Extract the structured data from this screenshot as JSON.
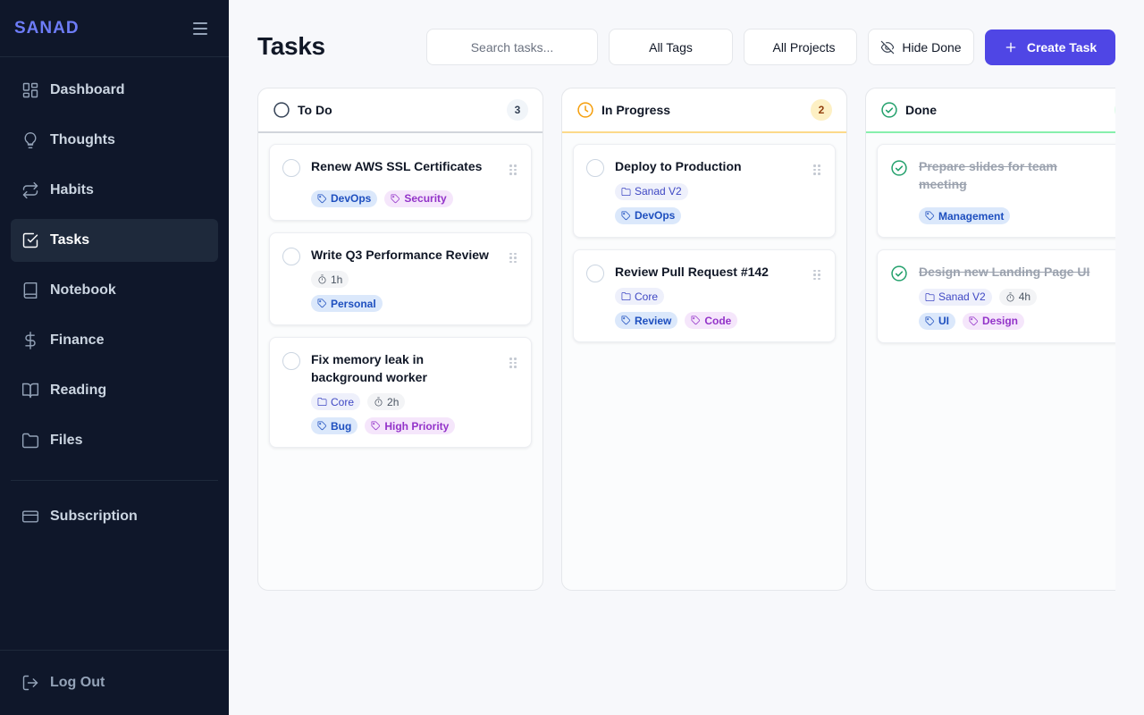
{
  "app": {
    "brand": "SANAD"
  },
  "sidebar": {
    "items": [
      {
        "label": "Dashboard",
        "icon": "grid-icon"
      },
      {
        "label": "Thoughts",
        "icon": "lightbulb-icon"
      },
      {
        "label": "Habits",
        "icon": "repeat-icon"
      },
      {
        "label": "Tasks",
        "icon": "checkbox-icon",
        "active": true
      },
      {
        "label": "Notebook",
        "icon": "notebook-icon"
      },
      {
        "label": "Finance",
        "icon": "dollar-icon"
      },
      {
        "label": "Reading",
        "icon": "book-open-icon"
      },
      {
        "label": "Files",
        "icon": "folder-icon"
      }
    ],
    "subscription": {
      "label": "Subscription",
      "icon": "credit-card-icon"
    },
    "logout": {
      "label": "Log Out",
      "icon": "logout-icon"
    }
  },
  "header": {
    "title": "Tasks",
    "search_placeholder": "Search tasks...",
    "tags_filter": "All Tags",
    "projects_filter": "All Projects",
    "hide_done": "Hide Done",
    "create_task": "Create Task"
  },
  "colors": {
    "accent": "#4f46e5",
    "todo": "#d1d5db",
    "in_progress": "#f59e0b",
    "done": "#22a06b"
  },
  "columns": [
    {
      "title": "To Do",
      "count": "3",
      "status_icon": "circle-icon",
      "cards": [
        {
          "title": "Renew AWS SSL Certificates",
          "tags": [
            "DevOps",
            "Security"
          ]
        },
        {
          "title": "Write Q3 Performance Review",
          "time": "1h",
          "tags": [
            "Personal"
          ]
        },
        {
          "title": "Fix memory leak in background worker",
          "project": "Core",
          "time": "2h",
          "tags": [
            "Bug",
            "High Priority"
          ]
        }
      ]
    },
    {
      "title": "In Progress",
      "count": "2",
      "status_icon": "clock-icon",
      "cards": [
        {
          "title": "Deploy to Production",
          "project": "Sanad V2",
          "tags": [
            "DevOps"
          ]
        },
        {
          "title": "Review Pull Request #142",
          "project": "Core",
          "tags": [
            "Review",
            "Code"
          ]
        }
      ]
    },
    {
      "title": "Done",
      "count": "",
      "status_icon": "check-circle-icon",
      "cards": [
        {
          "title": "Prepare slides for team meeting",
          "tags": [
            "Management"
          ]
        },
        {
          "title": "Design new Landing Page UI",
          "project": "Sanad V2",
          "time": "4h",
          "tags": [
            "UI",
            "Design"
          ]
        }
      ]
    }
  ]
}
